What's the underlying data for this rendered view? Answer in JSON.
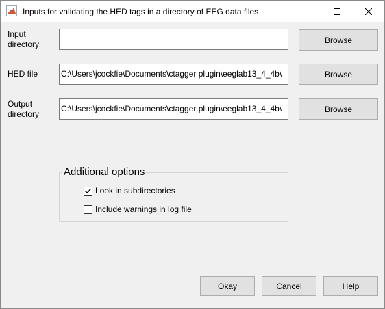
{
  "window": {
    "title": "Inputs for validating the HED tags in a directory of EEG data files"
  },
  "fields": [
    {
      "label_line1": "Input",
      "label_line2": "directory",
      "value": "",
      "browse_label": "Browse"
    },
    {
      "label_line1": "HED file",
      "label_line2": "",
      "value": "C:\\Users\\jcockfie\\Documents\\ctagger plugin\\eeglab13_4_4b\\",
      "browse_label": "Browse"
    },
    {
      "label_line1": "Output",
      "label_line2": "directory",
      "value": "C:\\Users\\jcockfie\\Documents\\ctagger plugin\\eeglab13_4_4b\\",
      "browse_label": "Browse"
    }
  ],
  "options": {
    "title": "Additional options",
    "look_in_subdirectories": {
      "label": "Look in subdirectories",
      "checked": true
    },
    "include_warnings": {
      "label": "Include warnings in log file",
      "checked": false
    }
  },
  "buttons": {
    "ok": "Okay",
    "cancel": "Cancel",
    "help": "Help"
  },
  "icons": {
    "app": "matlab-icon",
    "minimize": "minimize-icon",
    "maximize": "maximize-icon",
    "close": "close-icon"
  }
}
